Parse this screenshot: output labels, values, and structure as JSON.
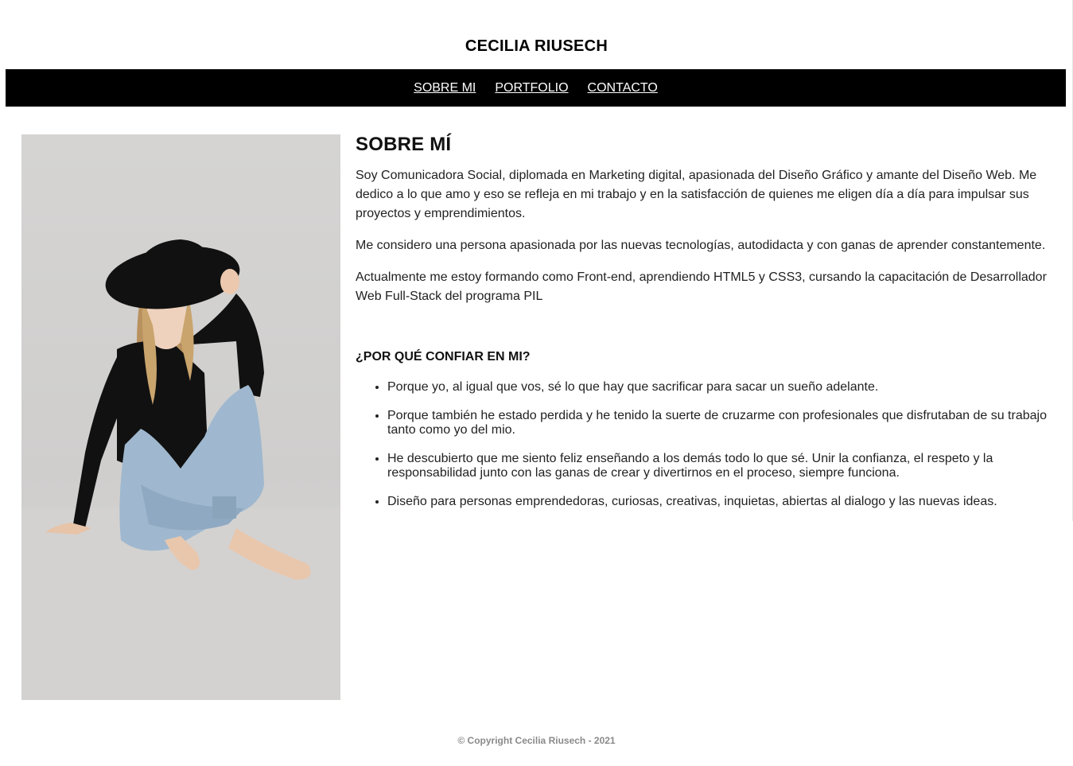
{
  "header": {
    "title": "CECILIA RIUSECH"
  },
  "nav": {
    "items": [
      "SOBRE MI",
      "PORTFOLIO",
      "CONTACTO"
    ]
  },
  "about": {
    "heading": "SOBRE MÍ",
    "paragraphs": [
      "Soy Comunicadora Social, diplomada en Marketing digital, apasionada del Diseño Gráfico y amante del Diseño Web. Me dedico a lo que amo y eso se refleja en mi trabajo y en la satisfacción de quienes me eligen día a día para impulsar sus proyectos y emprendimientos.",
      "Me considero una persona apasionada por las nuevas tecnologías, autodidacta y con ganas de aprender constantemente.",
      "Actualmente me estoy formando como Front-end, aprendiendo HTML5 y CSS3, cursando la capacitación de Desarrollador Web Full-Stack del programa PIL"
    ]
  },
  "why": {
    "heading": "¿POR QUÉ CONFIAR EN MI?",
    "items": [
      "Porque yo, al igual que vos, sé lo que hay que sacrificar para sacar un sueño adelante.",
      "Porque también he estado perdida y he tenido la suerte de cruzarme con profesionales que disfrutaban de su trabajo tanto como yo del mio.",
      "He descubierto que me siento feliz enseñando a los demás todo lo que sé. Unir la confianza, el respeto y la responsabilidad junto con las ganas de crear y divertirnos en el proceso, siempre funciona.",
      "Diseño para personas emprendedoras, curiosas, creativas, inquietas, abiertas al dialogo y las nuevas ideas."
    ]
  },
  "footer": {
    "copyright": "© Copyright Cecilia Riusech - 2021"
  }
}
